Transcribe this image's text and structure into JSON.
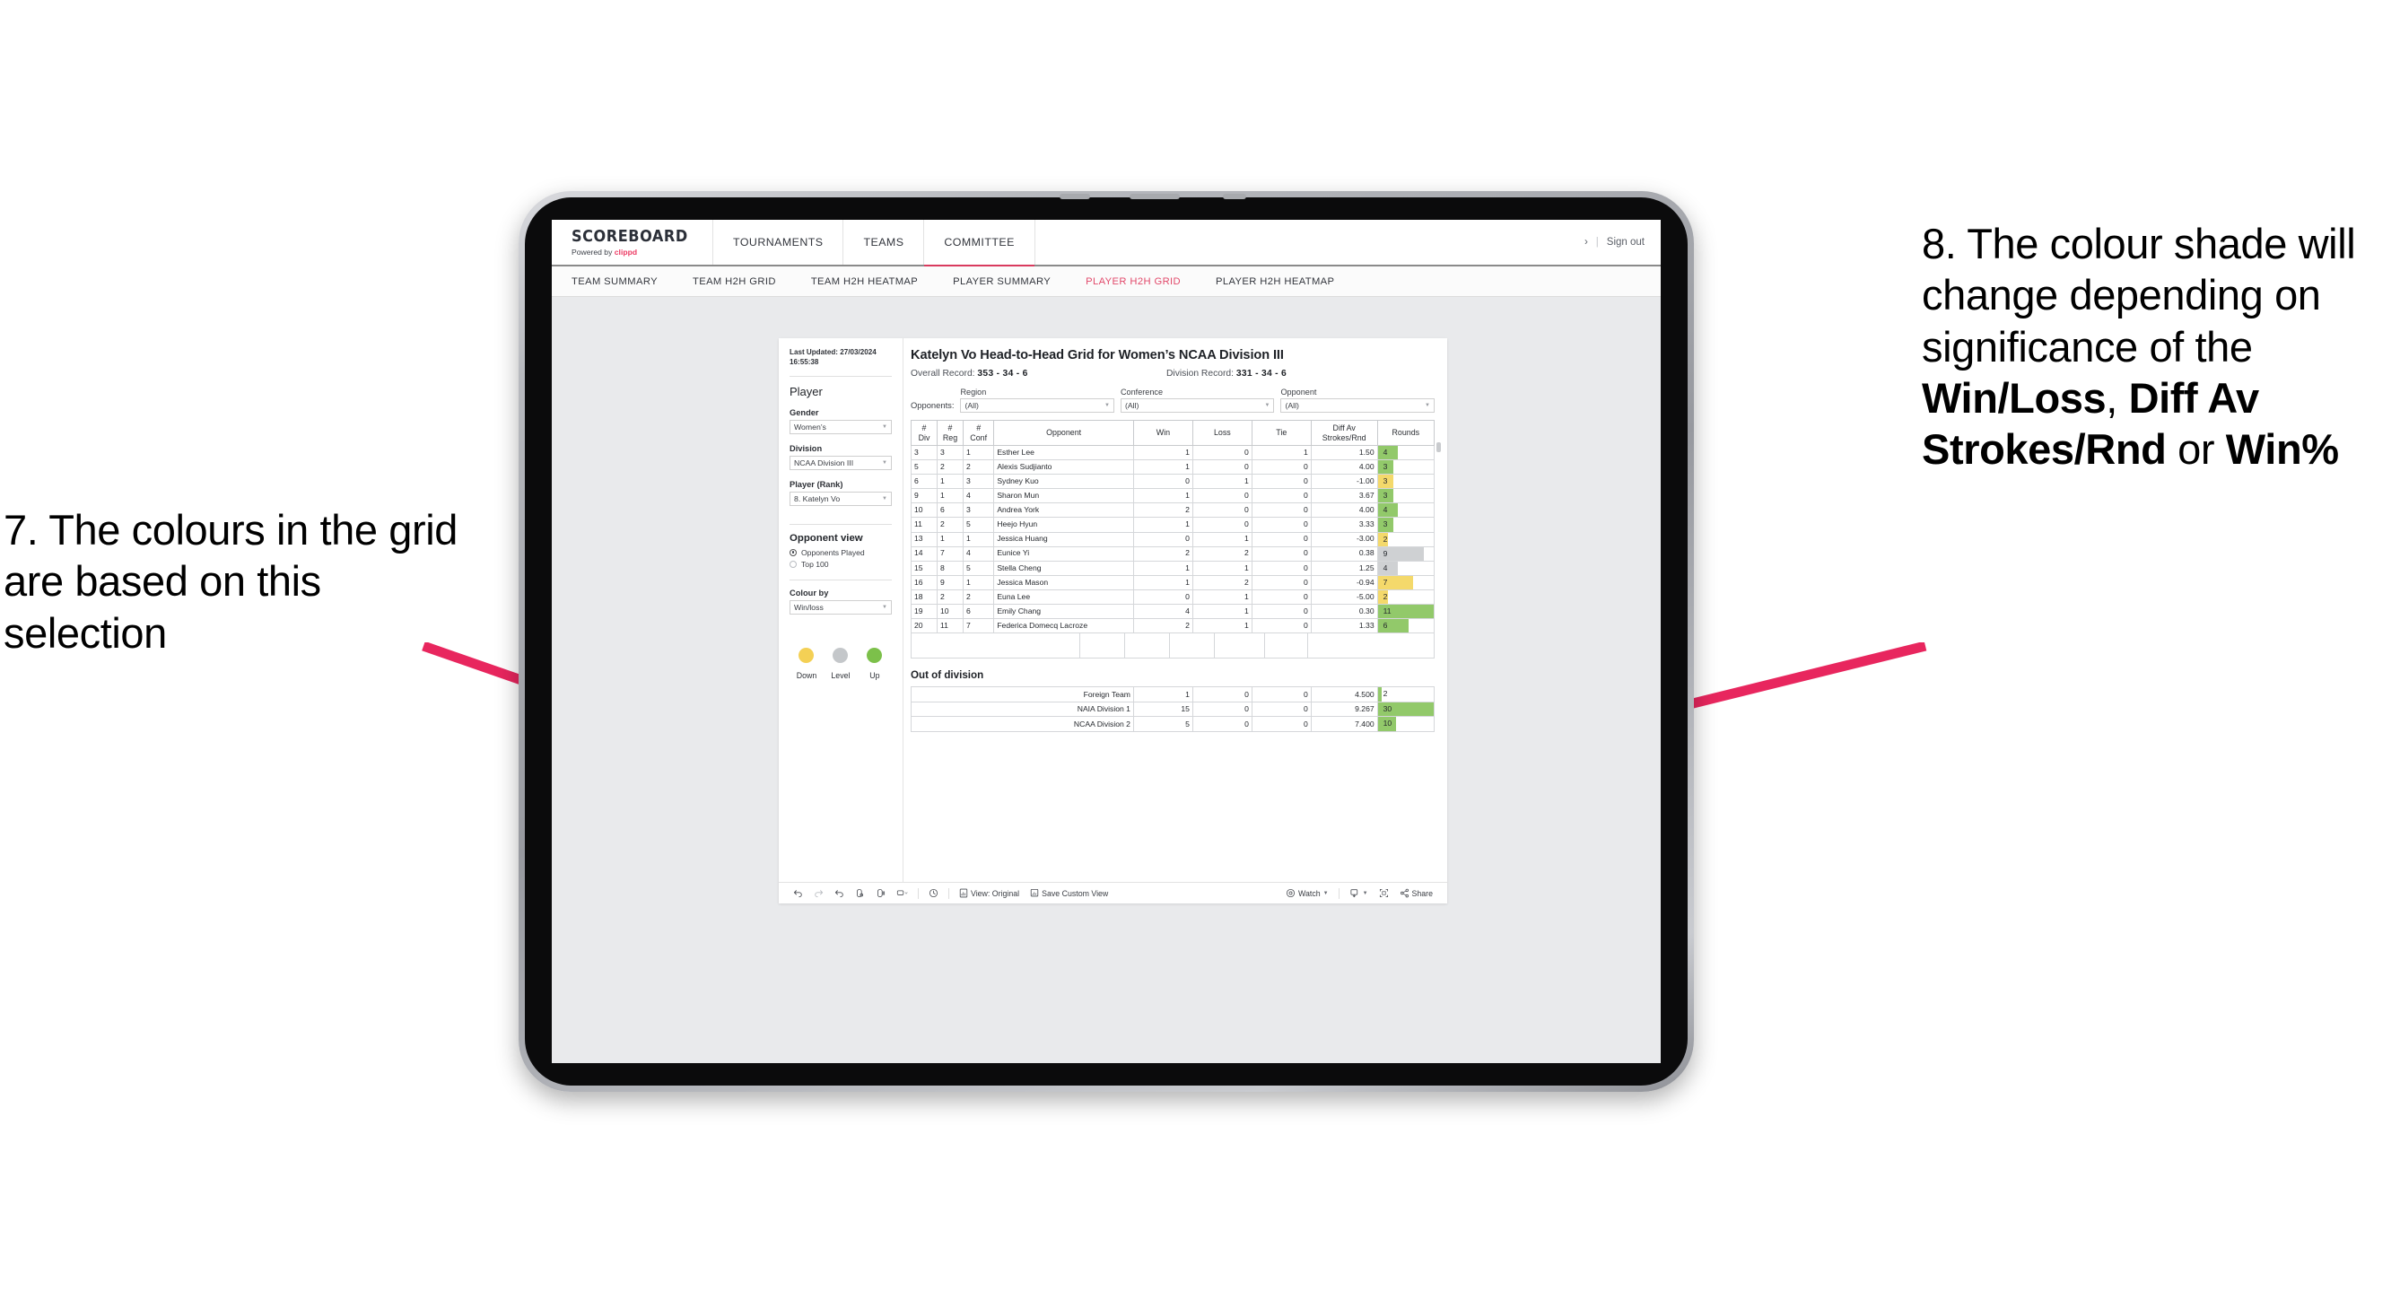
{
  "annotations": {
    "left": {
      "number": "7.",
      "text": "7. The colours in the grid are based on this selection"
    },
    "right": {
      "number": "8.",
      "line1": "8. The colour shade will change depending on significance of the ",
      "bold1": "Win/Loss",
      "mid1": ", ",
      "bold2": "Diff Av Strokes/Rnd",
      "mid2": " or ",
      "bold3": "Win%"
    },
    "arrow_color": "#e8265e"
  },
  "app": {
    "brand": {
      "title": "SCOREBOARD",
      "powered_by": "Powered by ",
      "vendor": "clippd"
    },
    "topnav": [
      {
        "label": "TOURNAMENTS",
        "active": false
      },
      {
        "label": "TEAMS",
        "active": false
      },
      {
        "label": "COMMITTEE",
        "active": true
      }
    ],
    "header_right": {
      "chevron": "›",
      "separator": "|",
      "signout": "Sign out"
    },
    "subnav": [
      {
        "label": "TEAM SUMMARY",
        "active": false
      },
      {
        "label": "TEAM H2H GRID",
        "active": false
      },
      {
        "label": "TEAM H2H HEATMAP",
        "active": false
      },
      {
        "label": "PLAYER SUMMARY",
        "active": false
      },
      {
        "label": "PLAYER H2H GRID",
        "active": true
      },
      {
        "label": "PLAYER H2H HEATMAP",
        "active": false
      }
    ]
  },
  "sidebar": {
    "last_updated": "Last Updated: 27/03/2024 16:55:38",
    "player_heading": "Player",
    "filters": [
      {
        "label": "Gender",
        "value": "Women’s"
      },
      {
        "label": "Division",
        "value": "NCAA Division III"
      },
      {
        "label": "Player (Rank)",
        "value": "8. Katelyn Vo"
      }
    ],
    "opponent_view": {
      "heading": "Opponent view",
      "options": [
        {
          "label": "Opponents Played",
          "selected": true
        },
        {
          "label": "Top 100",
          "selected": false
        }
      ]
    },
    "colour_by": {
      "label": "Colour by",
      "value": "Win/loss"
    },
    "legend": [
      {
        "label": "Down",
        "color": "#f4d055"
      },
      {
        "label": "Level",
        "color": "#c4c7ca"
      },
      {
        "label": "Up",
        "color": "#7cc04a"
      }
    ]
  },
  "main": {
    "title": "Katelyn Vo Head-to-Head Grid for Women’s NCAA Division III",
    "overall_record_label": "Overall Record: ",
    "overall_record": "353 -  34 - 6",
    "division_record_label": "Division Record: ",
    "division_record": "331 -  34 - 6",
    "opponents_label": "Opponents:",
    "opponent_filters": [
      {
        "label": "Region",
        "value": "(All)"
      },
      {
        "label": "Conference",
        "value": "(All)"
      },
      {
        "label": "Opponent",
        "value": "(All)"
      }
    ],
    "columns": [
      {
        "line1": "#",
        "line2": "Div"
      },
      {
        "line1": "#",
        "line2": "Reg"
      },
      {
        "line1": "#",
        "line2": "Conf"
      },
      {
        "line1": "Opponent",
        "line2": ""
      },
      {
        "line1": "Win",
        "line2": ""
      },
      {
        "line1": "Loss",
        "line2": ""
      },
      {
        "line1": "Tie",
        "line2": ""
      },
      {
        "line1": "Diff Av",
        "line2": "Strokes/Rnd"
      },
      {
        "line1": "Rounds",
        "line2": ""
      }
    ],
    "rows": [
      {
        "div": "3",
        "reg": "3",
        "conf": "1",
        "opponent": "Esther Lee",
        "win": "1",
        "loss": "0",
        "tie": "1",
        "diff": "1.50",
        "rounds": "4",
        "state": "up"
      },
      {
        "div": "5",
        "reg": "2",
        "conf": "2",
        "opponent": "Alexis Sudjianto",
        "win": "1",
        "loss": "0",
        "tie": "0",
        "diff": "4.00",
        "rounds": "3",
        "state": "up"
      },
      {
        "div": "6",
        "reg": "1",
        "conf": "3",
        "opponent": "Sydney Kuo",
        "win": "0",
        "loss": "1",
        "tie": "0",
        "diff": "-1.00",
        "rounds": "3",
        "state": "down"
      },
      {
        "div": "9",
        "reg": "1",
        "conf": "4",
        "opponent": "Sharon Mun",
        "win": "1",
        "loss": "0",
        "tie": "0",
        "diff": "3.67",
        "rounds": "3",
        "state": "up"
      },
      {
        "div": "10",
        "reg": "6",
        "conf": "3",
        "opponent": "Andrea York",
        "win": "2",
        "loss": "0",
        "tie": "0",
        "diff": "4.00",
        "rounds": "4",
        "state": "up"
      },
      {
        "div": "11",
        "reg": "2",
        "conf": "5",
        "opponent": "Heejo Hyun",
        "win": "1",
        "loss": "0",
        "tie": "0",
        "diff": "3.33",
        "rounds": "3",
        "state": "up"
      },
      {
        "div": "13",
        "reg": "1",
        "conf": "1",
        "opponent": "Jessica Huang",
        "win": "0",
        "loss": "1",
        "tie": "0",
        "diff": "-3.00",
        "rounds": "2",
        "state": "down"
      },
      {
        "div": "14",
        "reg": "7",
        "conf": "4",
        "opponent": "Eunice Yi",
        "win": "2",
        "loss": "2",
        "tie": "0",
        "diff": "0.38",
        "rounds": "9",
        "state": "level",
        "diff_state": "up"
      },
      {
        "div": "15",
        "reg": "8",
        "conf": "5",
        "opponent": "Stella Cheng",
        "win": "1",
        "loss": "1",
        "tie": "0",
        "diff": "1.25",
        "rounds": "4",
        "state": "level",
        "diff_state": "up"
      },
      {
        "div": "16",
        "reg": "9",
        "conf": "1",
        "opponent": "Jessica Mason",
        "win": "1",
        "loss": "2",
        "tie": "0",
        "diff": "-0.94",
        "rounds": "7",
        "state": "down"
      },
      {
        "div": "18",
        "reg": "2",
        "conf": "2",
        "opponent": "Euna Lee",
        "win": "0",
        "loss": "1",
        "tie": "0",
        "diff": "-5.00",
        "rounds": "2",
        "state": "down"
      },
      {
        "div": "19",
        "reg": "10",
        "conf": "6",
        "opponent": "Emily Chang",
        "win": "4",
        "loss": "1",
        "tie": "0",
        "diff": "0.30",
        "rounds": "11",
        "state": "up"
      },
      {
        "div": "20",
        "reg": "11",
        "conf": "7",
        "opponent": "Federica Domecq Lacroze",
        "win": "2",
        "loss": "1",
        "tie": "0",
        "diff": "1.33",
        "rounds": "6",
        "state": "up"
      }
    ],
    "out_of_division": {
      "title": "Out of division",
      "rows": [
        {
          "name": "Foreign Team",
          "win": "1",
          "loss": "0",
          "tie": "0",
          "diff": "4.500",
          "rounds": "2",
          "state": "up"
        },
        {
          "name": "NAIA Division 1",
          "win": "15",
          "loss": "0",
          "tie": "0",
          "diff": "9.267",
          "rounds": "30",
          "state": "up"
        },
        {
          "name": "NCAA Division 2",
          "win": "5",
          "loss": "0",
          "tie": "0",
          "diff": "7.400",
          "rounds": "10",
          "state": "up"
        }
      ]
    }
  },
  "toolbar": {
    "view_label": "View: Original",
    "save_label": "Save Custom View",
    "watch_label": "Watch",
    "share_label": "Share"
  },
  "colors": {
    "up": "#92c96a",
    "down": "#f4d96b",
    "level": "#cfd1d3",
    "accent": "#d93a5e",
    "brand_pink": "#ec3a63"
  }
}
